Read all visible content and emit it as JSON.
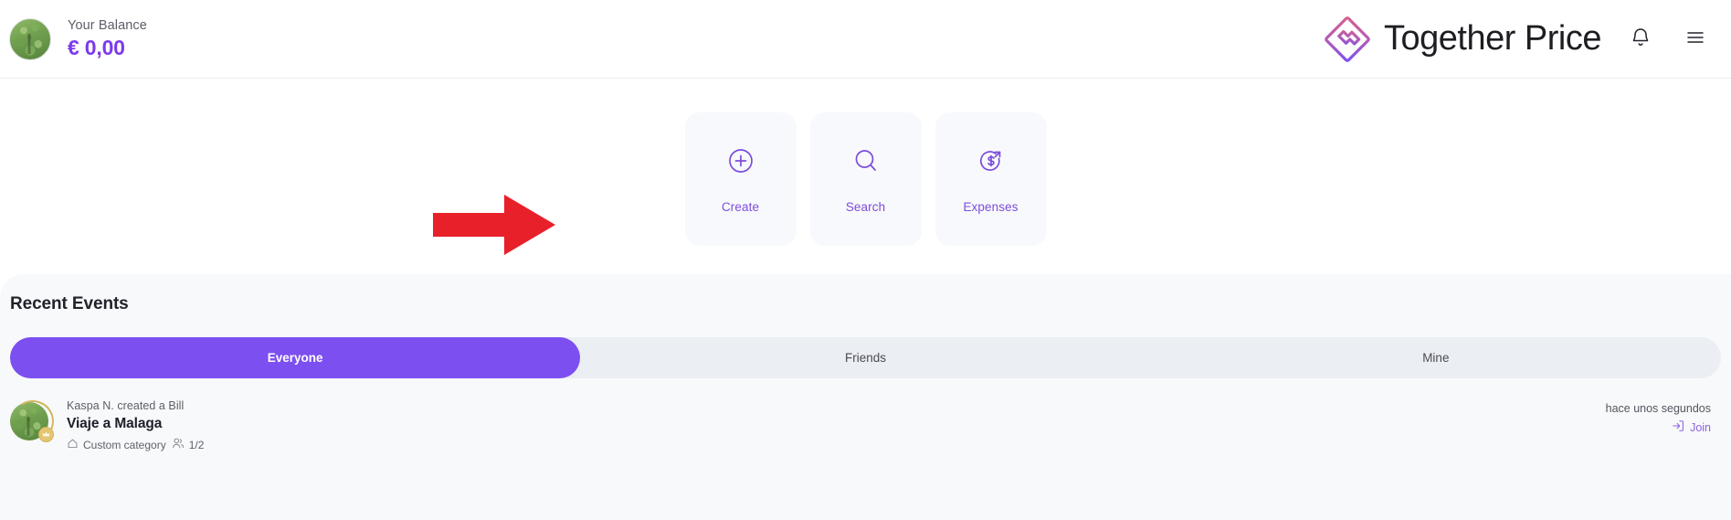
{
  "header": {
    "avatar_icon": "user-avatar-tree",
    "balance_label": "Your Balance",
    "balance_amount": "€ 0,00",
    "brand_name": "Together Price",
    "logo_icon": "together-price-diamond-logo",
    "notifications_icon": "bell-icon",
    "menu_icon": "hamburger-menu-icon"
  },
  "quick_actions": {
    "annotation_arrow_icon": "red-pointer-arrow",
    "cards": [
      {
        "label": "Create",
        "icon": "plus-circle-icon"
      },
      {
        "label": "Search",
        "icon": "magnifying-glass-icon"
      },
      {
        "label": "Expenses",
        "icon": "dollar-circle-arrow-icon"
      }
    ]
  },
  "recent_events": {
    "title": "Recent Events",
    "tabs": [
      {
        "label": "Everyone",
        "active": true
      },
      {
        "label": "Friends",
        "active": false
      },
      {
        "label": "Mine",
        "active": false
      }
    ],
    "events": [
      {
        "avatar_icon": "user-avatar-tree",
        "badge_icon": "gold-crown-badge-icon",
        "action_text": "Kaspa N. created a Bill",
        "title": "Viaje a Malaga",
        "category_icon": "category-tag-icon",
        "category": "Custom category",
        "members_icon": "people-icon",
        "members": "1/2",
        "timestamp": "hace unos segundos",
        "join_icon": "enter-arrow-icon",
        "join_label": "Join"
      }
    ]
  },
  "colors": {
    "accent_purple": "#7c4ff0",
    "balance_purple": "#7c3aed",
    "icon_purple": "#7c4ddb",
    "logo_pink": "#d6608f",
    "logo_violet": "#7c4ff0",
    "annotation_red": "#e8202a",
    "panel_bg": "#f8f9fb",
    "card_bg": "#f8f9fc",
    "tabs_bg": "#ebeef2",
    "badge_gold": "#d4b55e"
  }
}
